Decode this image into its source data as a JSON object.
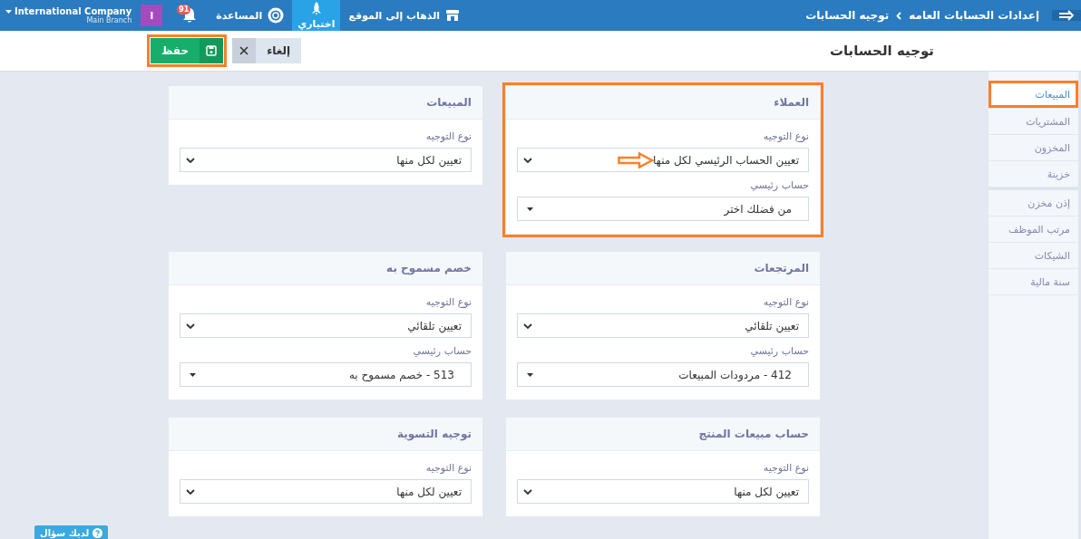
{
  "topbar": {
    "breadcrumb": [
      "إعدادات الحسابات العامه",
      "توجيه الحسابات"
    ],
    "links": [
      {
        "label": "الذهاب إلى الموقع",
        "selected": false
      },
      {
        "label": "اختباري",
        "selected": true
      },
      {
        "label": "المساعدة",
        "selected": false
      }
    ],
    "notifications": "91",
    "avatar": "I",
    "company": "International Company",
    "branch": "Main Branch"
  },
  "page": {
    "title": "توجيه الحسابات",
    "buttons": [
      {
        "label": "إلغاء",
        "kind": "cancel",
        "highlighted": false
      },
      {
        "label": "حفظ",
        "kind": "save",
        "highlighted": true
      }
    ]
  },
  "sidebar": {
    "groups": [
      [
        {
          "label": "المبيعات",
          "selected": true,
          "highlighted": true
        },
        {
          "label": "المشتريات",
          "selected": false,
          "highlighted": false
        },
        {
          "label": "المخزون",
          "selected": false,
          "highlighted": false
        },
        {
          "label": "خزينة",
          "selected": false,
          "highlighted": false
        }
      ],
      [
        {
          "label": "إذن مخزن",
          "selected": false,
          "highlighted": false
        },
        {
          "label": "مرتب الموظف",
          "selected": false,
          "highlighted": false
        },
        {
          "label": "الشيكات",
          "selected": false,
          "highlighted": false
        },
        {
          "label": "سنة مالية",
          "selected": false,
          "highlighted": false
        }
      ]
    ]
  },
  "cards": [
    {
      "title": "العملاء",
      "highlighted": true,
      "fields": [
        {
          "label": "نوع التوجيه",
          "value": "تعيين الحساب الرئيسي لكل منها",
          "kind": "select",
          "annotated": true
        },
        {
          "label": "حساب رئيسي",
          "value": "من فضلك اختر",
          "kind": "combo",
          "annotated": false
        }
      ]
    },
    {
      "title": "المبيعات",
      "highlighted": false,
      "fields": [
        {
          "label": "نوع التوجيه",
          "value": "تعيين لكل منها",
          "kind": "select",
          "annotated": false
        }
      ]
    },
    {
      "title": "المرتجعات",
      "highlighted": false,
      "fields": [
        {
          "label": "نوع التوجيه",
          "value": "تعيين تلقائي",
          "kind": "select",
          "annotated": false
        },
        {
          "label": "حساب رئيسي",
          "value": "412 - مردودات المبيعات",
          "kind": "combo",
          "annotated": false
        }
      ]
    },
    {
      "title": "خصم مسموح به",
      "highlighted": false,
      "fields": [
        {
          "label": "نوع التوجيه",
          "value": "تعيين تلقائي",
          "kind": "select",
          "annotated": false
        },
        {
          "label": "حساب رئيسي",
          "value": "513 - خصم مسموح به",
          "kind": "combo",
          "annotated": false
        }
      ]
    },
    {
      "title": "حساب مبيعات المنتج",
      "highlighted": false,
      "fields": [
        {
          "label": "نوع التوجيه",
          "value": "تعيين لكل منها",
          "kind": "select",
          "annotated": false
        }
      ]
    },
    {
      "title": "توجيه التسوية",
      "highlighted": false,
      "fields": [
        {
          "label": "نوع التوجيه",
          "value": "تعيين لكل منها",
          "kind": "select",
          "annotated": false
        }
      ]
    }
  ],
  "help_button": "لديك سؤال"
}
